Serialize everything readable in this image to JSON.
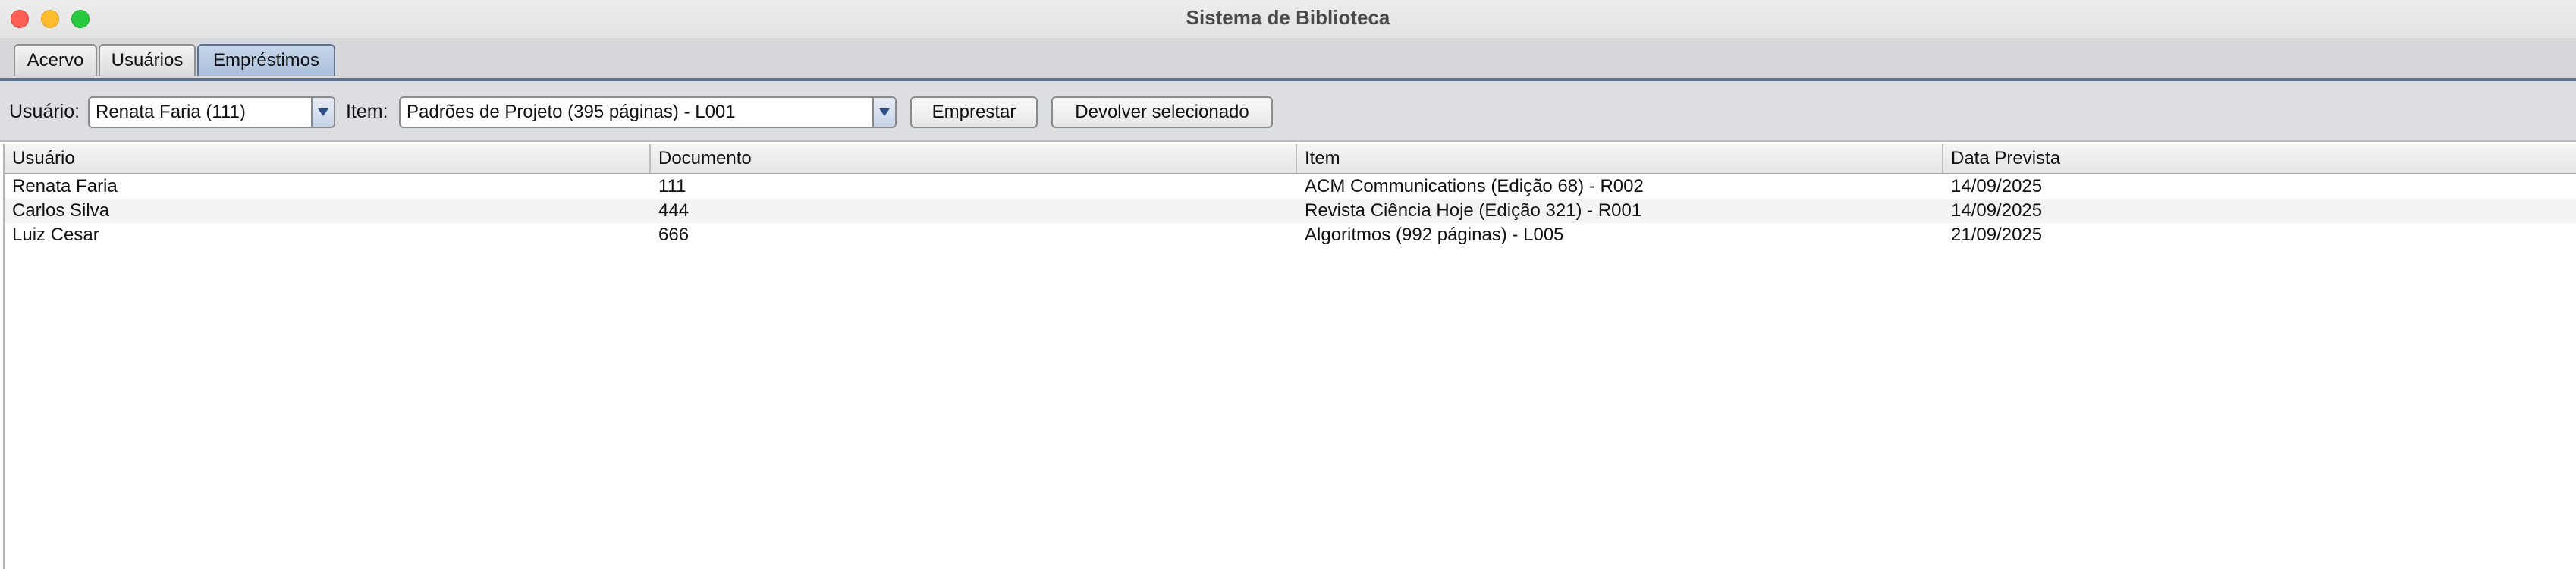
{
  "window": {
    "title": "Sistema de Biblioteca"
  },
  "tabs": [
    {
      "label": "Acervo",
      "selected": false
    },
    {
      "label": "Usuários",
      "selected": false
    },
    {
      "label": "Empréstimos",
      "selected": true
    }
  ],
  "toolbar": {
    "user_label": "Usuário:",
    "user_selected": "Renata Faria (111)",
    "item_label": "Item:",
    "item_selected": "Padrões de Projeto (395 páginas) - L001",
    "lend_button": "Emprestar",
    "return_button": "Devolver selecionado"
  },
  "table": {
    "columns": [
      "Usuário",
      "Documento",
      "Item",
      "Data Prevista"
    ],
    "rows": [
      [
        "Renata Faria",
        "111",
        "ACM Communications (Edição 68) - R002",
        "14/09/2025"
      ],
      [
        "Carlos Silva",
        "444",
        "Revista Ciência Hoje (Edição 321) - R001",
        "14/09/2025"
      ],
      [
        "Luiz Cesar",
        "666",
        "Algoritmos (992 páginas) - L005",
        "21/09/2025"
      ]
    ]
  },
  "colors": {
    "selected_tab": "#a9bfdb",
    "close": "#fe5f57",
    "minimize": "#febc2e",
    "maximize": "#28c840"
  }
}
